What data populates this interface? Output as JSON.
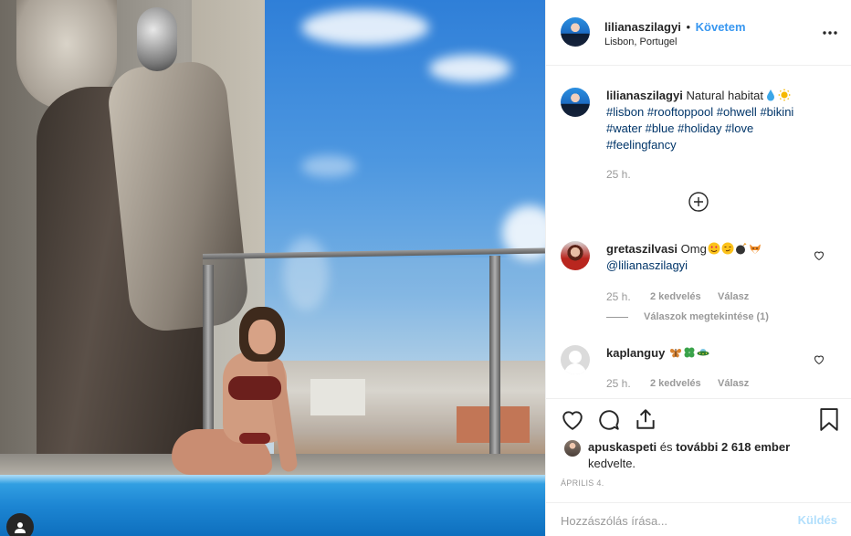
{
  "post": {
    "username": "lilianaszilagyi",
    "follow_separator": "•",
    "follow_label": "Követem",
    "location": "Lisbon, Portugel"
  },
  "caption": {
    "username": "lilianaszilagyi",
    "text": "Natural habitat",
    "emojis": [
      "droplet-emoji",
      "sun-emoji"
    ],
    "hashtags_line1": [
      "#lisbon",
      "#rooftoppool",
      "#ohwell",
      "#bikini"
    ],
    "hashtags_line2": [
      "#water",
      "#blue",
      "#holiday",
      "#love"
    ],
    "hashtags_line3": [
      "#feelingfancy"
    ],
    "time": "25 h."
  },
  "comments": [
    {
      "username": "gretaszilvasi",
      "text": "Omg",
      "emojis": [
        "heart-eyes-emoji",
        "smirk-emoji",
        "bomb-emoji",
        "fox-emoji"
      ],
      "mention": "@lilianaszilagyi",
      "time": "25 h.",
      "likes": "2 kedvelés",
      "reply_label": "Válasz",
      "view_replies": "Válaszok megtekintése (1)"
    },
    {
      "username": "kaplanguy",
      "text": "",
      "emojis": [
        "butterfly-emoji",
        "clover-emoji",
        "ufo-emoji"
      ],
      "time": "25 h.",
      "likes": "2 kedvelés",
      "reply_label": "Válasz"
    }
  ],
  "likes": {
    "liker": "apuskaspeti",
    "connector": "és",
    "others": "további 2 618 ember",
    "suffix": "kedvelte."
  },
  "date": "ÁPRILIS 4.",
  "comment_input": {
    "placeholder": "Hozzászólás írása...",
    "submit_label": "Küldés"
  },
  "colors": {
    "accent_blue": "#3897f0",
    "hashtag": "#003569",
    "muted": "#999999",
    "submit_disabled": "#b2dffc",
    "text": "#262626"
  }
}
